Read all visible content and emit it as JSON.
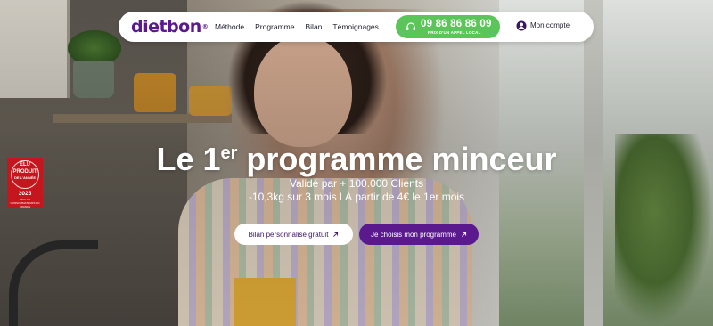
{
  "brand": {
    "logo_text": "dietbon",
    "logo_mark": "®",
    "color_primary": "#5a1a8e",
    "color_phone": "#5cc55a"
  },
  "nav": {
    "links": [
      "Méthode",
      "Programme",
      "Bilan",
      "Témoignages"
    ],
    "phone_number": "09 86 86 86 09",
    "phone_subtitle": "PRIX D'UN APPEL LOCAL",
    "phone_icon": "headset-icon",
    "account_label": "Mon compte",
    "account_icon": "user-circle-icon"
  },
  "hero": {
    "headline_prefix": "Le 1",
    "headline_sup": "er",
    "headline_suffix": " programme minceur",
    "subline_1": "Validé par + 100.000 Clients",
    "subline_2": "-10,3kg sur 3 mois l À partir de 4€ le 1er mois",
    "cta_secondary": "Bilan personnalisé gratuit",
    "cta_primary": "Je choisis mon programme",
    "cta_icon": "arrow-up-right-icon"
  },
  "badge": {
    "line1": "ÉLU",
    "line2": "PRODUIT",
    "line3": "DE L'ANNÉE",
    "year": "2025",
    "footer": "PAR LES CONSOMMATEURS EN FRANCE",
    "color": "#c4161c"
  }
}
